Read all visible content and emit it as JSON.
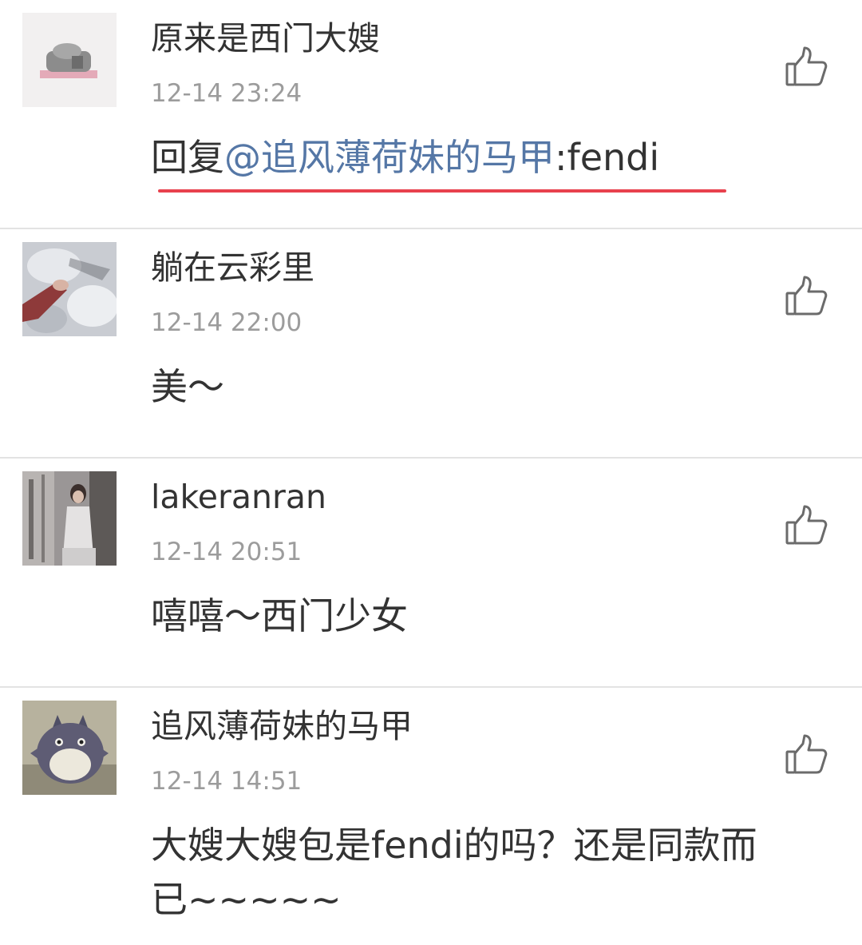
{
  "accent_color": "#e8414d",
  "mention_color": "#5577a6",
  "comments": [
    {
      "username": "原来是西门大嫂",
      "time": "12-14 23:24",
      "reply_prefix": "回复",
      "mention": "@追风薄荷妹的马甲",
      "text": ":fendi",
      "avatar": "avatar-stone-figure",
      "like_icon": "thumbs-up-icon"
    },
    {
      "username": "躺在云彩里",
      "time": "12-14 22:00",
      "text": "美～",
      "avatar": "avatar-snow-hand",
      "like_icon": "thumbs-up-icon"
    },
    {
      "username": "lakeranran",
      "time": "12-14 20:51",
      "text": "嘻嘻～西门少女",
      "avatar": "avatar-woman-street",
      "like_icon": "thumbs-up-icon"
    },
    {
      "username": "追风薄荷妹的马甲",
      "time": "12-14 14:51",
      "text": "大嫂大嫂包是fendi的吗？还是同款而已~~~~~",
      "avatar": "avatar-totoro-plush",
      "like_icon": "thumbs-up-icon"
    }
  ]
}
